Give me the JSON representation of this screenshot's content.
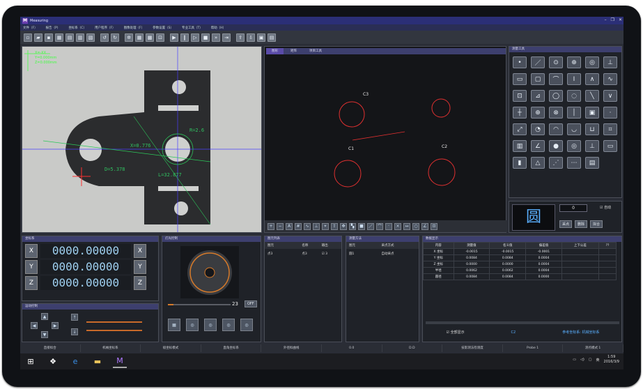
{
  "app": {
    "title": "Measuring",
    "window_controls": [
      "–",
      "❐",
      "✕"
    ]
  },
  "menu": [
    "文件（F）",
    "报告（P）",
    "坐标系（C）",
    "用户程序（F）",
    "图像处理（F）",
    "参数设置（S）",
    "专业工具（T）",
    "帮助（H）"
  ],
  "toolbar_icons": [
    "new",
    "open",
    "save",
    "save-as",
    "print",
    "print2",
    "print3",
    "undo",
    "redo",
    "settings",
    "grid",
    "color",
    "fit",
    "run",
    "pause",
    "step",
    "stop",
    "fast",
    "next",
    "export",
    "export2",
    "report",
    "table"
  ],
  "camera": {
    "readout": [
      "X=-XX",
      "Y=0.000mm",
      "Z=0.000mm"
    ],
    "labels": {
      "r1": "R=2.6",
      "x1": "X=0.776",
      "d1": "D=5.378",
      "l1": "L=32.877"
    }
  },
  "cad": {
    "tabs": [
      "图形",
      "矩阵",
      "项目工具"
    ],
    "labels": [
      "C3",
      "C1",
      "C2"
    ],
    "bottom_tools": [
      "zoom-in",
      "zoom-out",
      "text",
      "grid",
      "curve",
      "axis",
      "snap",
      "export",
      "pan",
      "fill",
      "box",
      "line",
      "arc",
      "point",
      "x1",
      "dim",
      "circle",
      "angle",
      "measure"
    ]
  },
  "tools": {
    "title": "测量工具",
    "cells": [
      "•",
      "／",
      "⊙",
      "⊕",
      "◎",
      "⊥",
      "▭",
      "▢",
      "⌒",
      "Ⅰ",
      "∧",
      "∿",
      "⊡",
      "⊿",
      "◯",
      "◌",
      "╲",
      "∨",
      "┼",
      "⊕",
      "⊗",
      "│",
      "▣",
      "·",
      "⤢",
      "◔",
      "◠",
      "◡",
      "⊔",
      "⌗",
      "▥",
      "∠",
      "●",
      "◎",
      "⊥",
      "▭",
      "▮",
      "△",
      "⋰",
      "⋯",
      "▤"
    ]
  },
  "shape": {
    "glyph": "圆",
    "count": "0",
    "auto_label": "自动",
    "buttons": [
      "采点",
      "删除",
      "拟合"
    ]
  },
  "coords": {
    "title": "坐标系",
    "axes": [
      {
        "label": "X",
        "value": "0000.00000",
        "right": "X"
      },
      {
        "label": "Y",
        "value": "0000.00000",
        "right": "Y"
      },
      {
        "label": "Z",
        "value": "0000.00000",
        "right": "Z"
      }
    ]
  },
  "motion": {
    "title": "运动控制"
  },
  "light": {
    "title": "灯光控制",
    "value": "23",
    "off_label": "OFF"
  },
  "elements": {
    "title": "图元列表",
    "cols": [
      "图元",
      "名称",
      "输出"
    ],
    "rows": [
      [
        "点3",
        "点3",
        "☑ 3"
      ]
    ]
  },
  "method": {
    "title": "测量方法",
    "cols": [
      "图元",
      "采点方式"
    ],
    "rows": [
      [
        "圆1",
        "自动采点"
      ]
    ]
  },
  "data": {
    "title": "数据显示",
    "cols": [
      "内容",
      "测量值",
      "名义值",
      "偏差值",
      "上下公差",
      "??"
    ],
    "rows": [
      [
        "X 坐标",
        "-0.0015",
        "-0.0015",
        "-0.0001",
        ""
      ],
      [
        "Y 坐标",
        "0.0084",
        "0.0084",
        "0.0004",
        ""
      ],
      [
        "Z 坐标",
        "0.0000",
        "0.0000",
        "0.0004",
        ""
      ],
      [
        "半径",
        "0.0062",
        "0.0062",
        "0.0004",
        ""
      ],
      [
        "圆径",
        "0.0084",
        "0.0084",
        "0.0000",
        ""
      ]
    ],
    "show_all": "全部显示",
    "current": "C2",
    "ref": "参考坐标系: 机械坐标系"
  },
  "status": [
    "直接拟合",
    "机械坐标系",
    "极坐标模式",
    "直角坐标系",
    "外径拟曲线",
    "0.0",
    "D.D",
    "技影测法检测度",
    "Probe 1",
    "测点模式 1"
  ],
  "taskbar": {
    "time": "1:59",
    "date": "2016/3/9",
    "lang": "英"
  },
  "colors": {
    "accent": "#5a4ba8",
    "green": "#40ff40",
    "red": "#ff3030",
    "cyan": "#9fd0f0"
  }
}
